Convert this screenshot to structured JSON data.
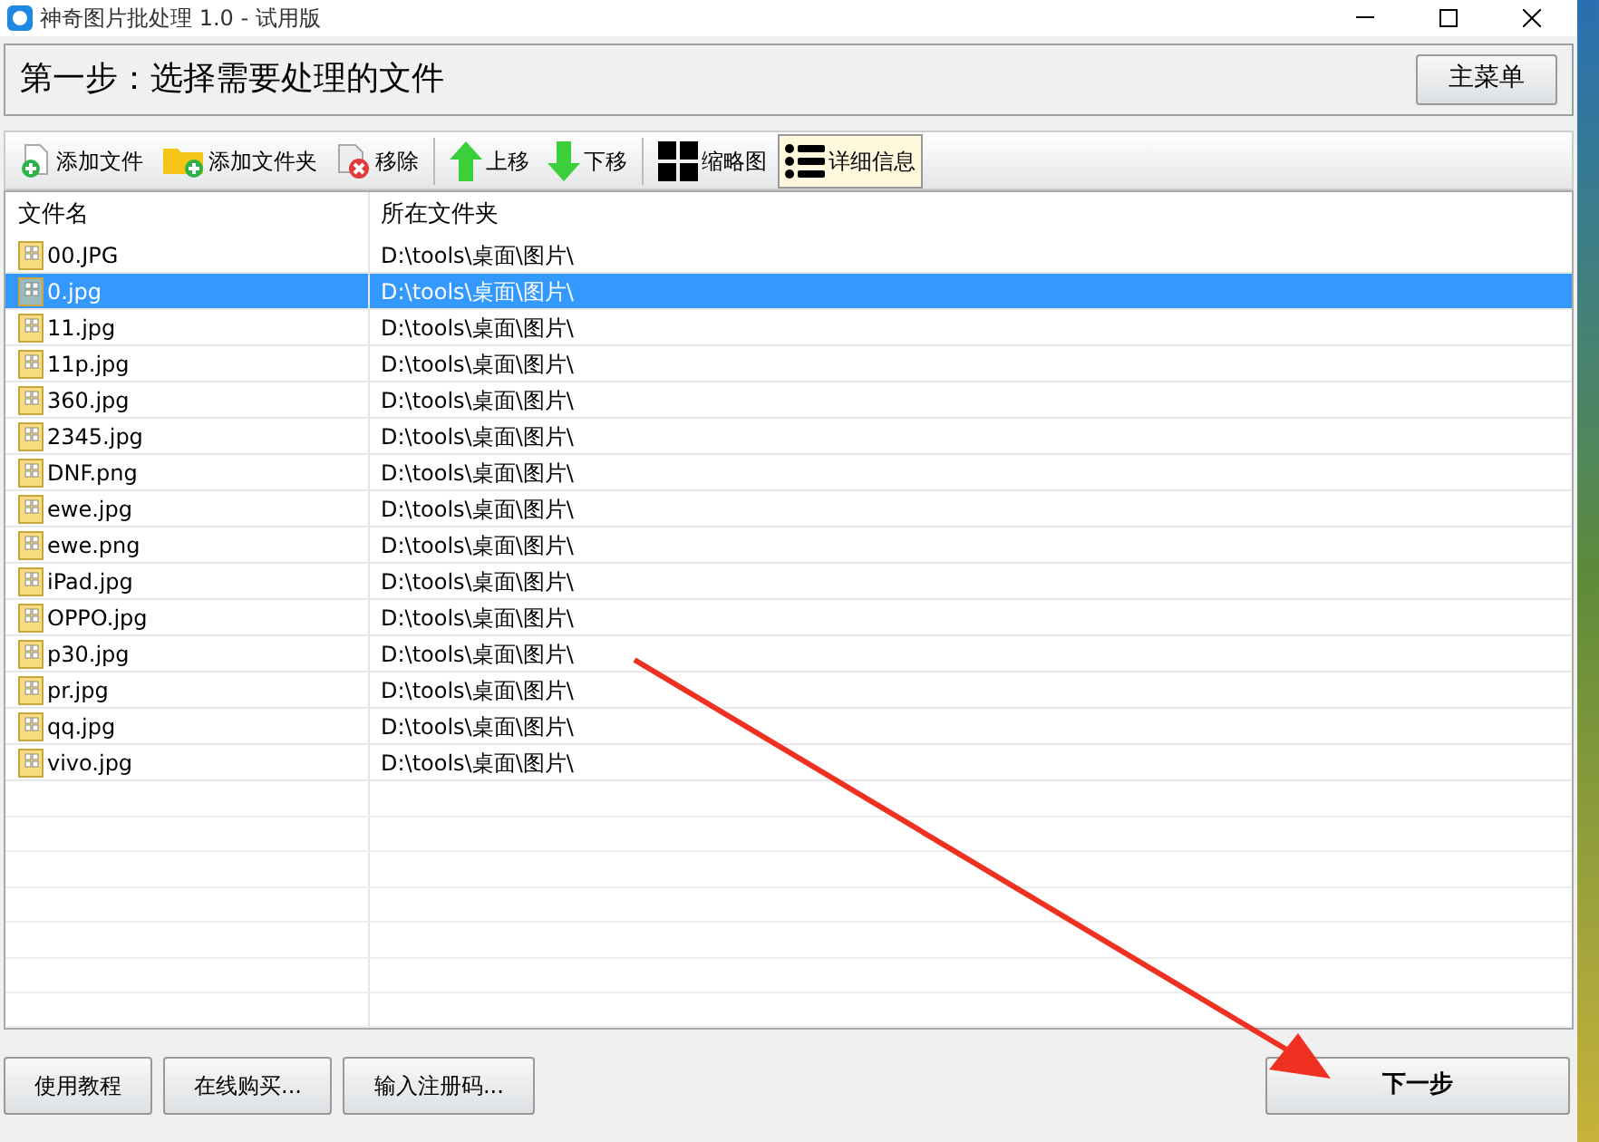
{
  "window": {
    "title": "神奇图片批处理 1.0 - 试用版"
  },
  "step_heading": "第一步：选择需要处理的文件",
  "main_menu_button": "主菜单",
  "toolbar": [
    {
      "kind": "add-file",
      "label": "添加文件"
    },
    {
      "kind": "add-folder",
      "label": "添加文件夹"
    },
    {
      "kind": "remove",
      "label": "移除"
    },
    {
      "kind": "separator"
    },
    {
      "kind": "move-up",
      "label": "上移"
    },
    {
      "kind": "move-down",
      "label": "下移"
    },
    {
      "kind": "separator"
    },
    {
      "kind": "thumbnails",
      "label": "缩略图",
      "selected": false
    },
    {
      "kind": "details",
      "label": "详细信息",
      "selected": true
    }
  ],
  "table": {
    "columns": [
      "文件名",
      "所在文件夹"
    ],
    "rows": [
      {
        "name": "00.JPG",
        "folder": "D:\\tools\\桌面\\图片\\",
        "selected": false
      },
      {
        "name": "0.jpg",
        "folder": "D:\\tools\\桌面\\图片\\",
        "selected": true
      },
      {
        "name": "11.jpg",
        "folder": "D:\\tools\\桌面\\图片\\",
        "selected": false
      },
      {
        "name": "11p.jpg",
        "folder": "D:\\tools\\桌面\\图片\\",
        "selected": false
      },
      {
        "name": "360.jpg",
        "folder": "D:\\tools\\桌面\\图片\\",
        "selected": false
      },
      {
        "name": "2345.jpg",
        "folder": "D:\\tools\\桌面\\图片\\",
        "selected": false
      },
      {
        "name": "DNF.png",
        "folder": "D:\\tools\\桌面\\图片\\",
        "selected": false
      },
      {
        "name": "ewe.jpg",
        "folder": "D:\\tools\\桌面\\图片\\",
        "selected": false
      },
      {
        "name": "ewe.png",
        "folder": "D:\\tools\\桌面\\图片\\",
        "selected": false
      },
      {
        "name": "iPad.jpg",
        "folder": "D:\\tools\\桌面\\图片\\",
        "selected": false
      },
      {
        "name": "OPPO.jpg",
        "folder": "D:\\tools\\桌面\\图片\\",
        "selected": false
      },
      {
        "name": "p30.jpg",
        "folder": "D:\\tools\\桌面\\图片\\",
        "selected": false
      },
      {
        "name": "pr.jpg",
        "folder": "D:\\tools\\桌面\\图片\\",
        "selected": false
      },
      {
        "name": "qq.jpg",
        "folder": "D:\\tools\\桌面\\图片\\",
        "selected": false
      },
      {
        "name": "vivo.jpg",
        "folder": "D:\\tools\\桌面\\图片\\",
        "selected": false
      }
    ]
  },
  "bottom_buttons": [
    "使用教程",
    "在线购买...",
    "输入注册码..."
  ],
  "next_button": "下一步"
}
